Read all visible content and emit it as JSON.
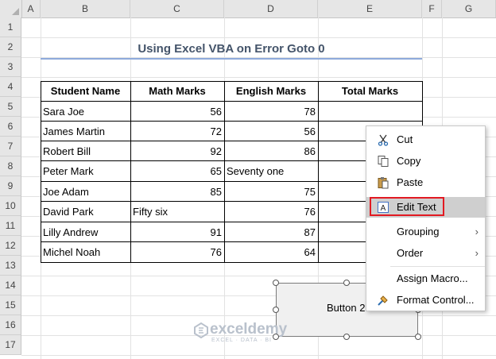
{
  "columns": [
    "A",
    "B",
    "C",
    "D",
    "E",
    "F",
    "G"
  ],
  "rows": [
    "1",
    "2",
    "3",
    "4",
    "5",
    "6",
    "7",
    "8",
    "9",
    "10",
    "11",
    "12",
    "13",
    "14",
    "15",
    "16",
    "17"
  ],
  "title": "Using Excel VBA on Error Goto 0",
  "table": {
    "headers": [
      "Student Name",
      "Math Marks",
      "English Marks",
      "Total Marks"
    ],
    "rows": [
      {
        "name": "Sara Joe",
        "math": "56",
        "english": "78",
        "total": ""
      },
      {
        "name": "James Martin",
        "math": "72",
        "english": "56",
        "total": ""
      },
      {
        "name": "Robert Bill",
        "math": "92",
        "english": "86",
        "total": ""
      },
      {
        "name": "Peter Mark",
        "math": "65",
        "english": "Seventy one",
        "total": ""
      },
      {
        "name": "Joe Adam",
        "math": "85",
        "english": "75",
        "total": ""
      },
      {
        "name": "David Park",
        "math": "Fifty six",
        "english": "76",
        "total": ""
      },
      {
        "name": "Lilly Andrew",
        "math": "91",
        "english": "87",
        "total": ""
      },
      {
        "name": "Michel Noah",
        "math": "76",
        "english": "64",
        "total": ""
      }
    ]
  },
  "button": {
    "label": "Button 2"
  },
  "context_menu": {
    "items": [
      {
        "label": "Cut",
        "icon": "scissors-icon"
      },
      {
        "label": "Copy",
        "icon": "copy-icon"
      },
      {
        "label": "Paste",
        "icon": "paste-icon"
      },
      {
        "label": "Edit Text",
        "icon": "edit-text-icon",
        "selected": true
      },
      {
        "label": "Grouping",
        "icon": "",
        "submenu": true
      },
      {
        "label": "Order",
        "icon": "",
        "submenu": true
      },
      {
        "label": "Assign Macro...",
        "icon": ""
      },
      {
        "label": "Format Control...",
        "icon": "format-control-icon"
      }
    ],
    "highlight_color": "#e21a22"
  },
  "watermark": {
    "name": "exceldemy",
    "tagline": "EXCEL · DATA · BI"
  }
}
